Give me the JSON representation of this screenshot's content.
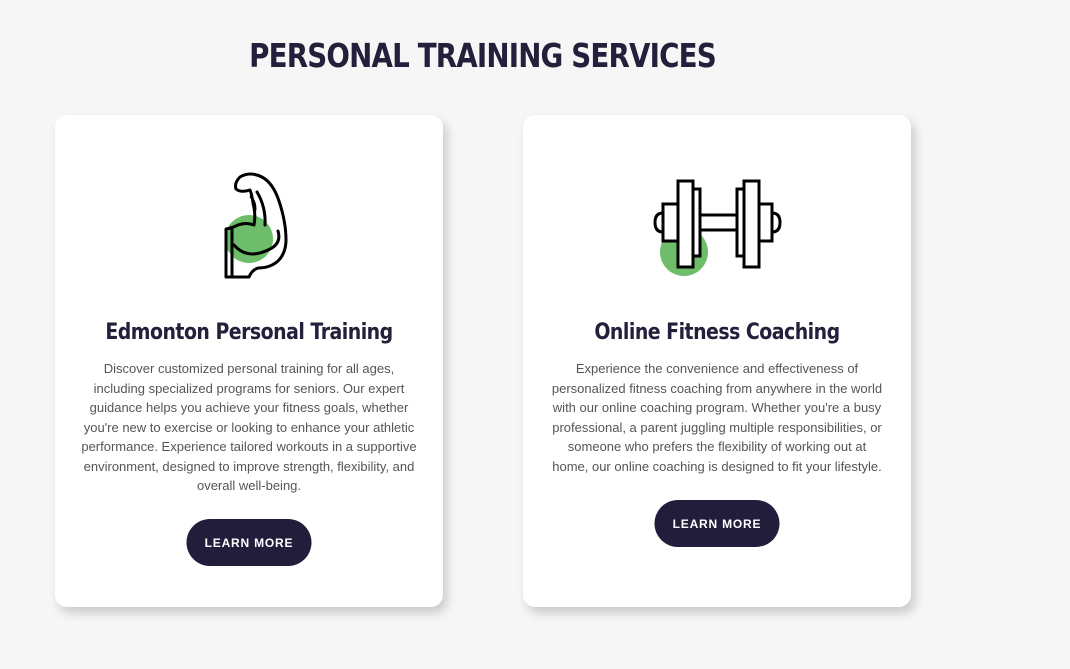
{
  "section": {
    "title": "PERSONAL TRAINING SERVICES"
  },
  "colors": {
    "background": "#f6f6f6",
    "heading": "#22203a",
    "button": "#211d3b",
    "icon_accent": "#6dbd6a"
  },
  "cards": [
    {
      "icon": "flexed-bicep-icon",
      "title": "Edmonton Personal Training",
      "description": "Discover customized personal training for all ages, including specialized programs for seniors. Our expert guidance helps you achieve your fitness goals, whether you're new to exercise or looking to enhance your athletic performance. Experience tailored workouts in a supportive environment, designed to improve strength, flexibility, and overall well-being.",
      "button_label": "LEARN MORE"
    },
    {
      "icon": "dumbbell-icon",
      "title": "Online Fitness Coaching",
      "description": "Experience the convenience and effectiveness of personalized fitness coaching from anywhere in the world with our online coaching program. Whether you're a busy professional, a parent juggling multiple responsibilities, or someone who prefers the flexibility of working out at home, our online coaching is designed to fit your lifestyle.",
      "button_label": "LEARN MORE"
    }
  ]
}
